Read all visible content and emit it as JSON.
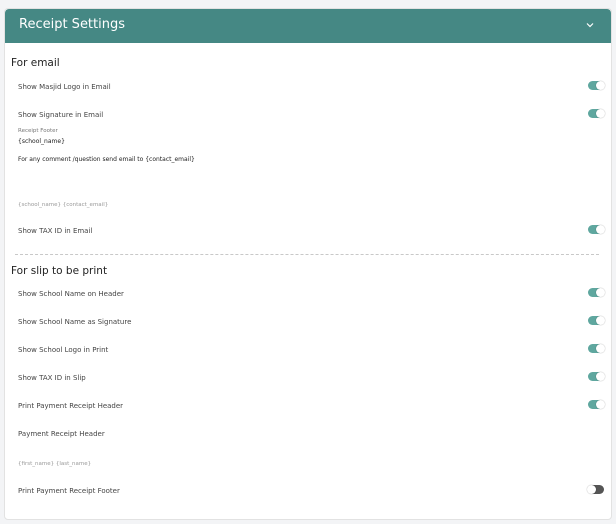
{
  "header": {
    "title": "Receipt Settings",
    "chevron_icon": "chevron-down-icon"
  },
  "colors": {
    "header_bg": "#458884",
    "toggle_on": "#5fa79f",
    "toggle_off": "#555555"
  },
  "email_section": {
    "title": "For email",
    "show_logo": {
      "label": "Show Masjid Logo in Email",
      "on": true
    },
    "show_signature": {
      "label": "Show Signature in Email",
      "on": true
    },
    "footer_label": "Receipt Footer",
    "footer_line1": "{school_name}",
    "footer_line2": "For any comment /question send email to {contact_email}",
    "footer_hint": "{school_name} {contact_email}",
    "show_tax": {
      "label": "Show TAX ID in Email",
      "on": true
    }
  },
  "slip_section": {
    "title": "For slip to be print",
    "school_name_header": {
      "label": "Show School Name on Header",
      "on": true
    },
    "school_name_signature": {
      "label": "Show School Name as Signature",
      "on": true
    },
    "school_logo": {
      "label": "Show School Logo in Print",
      "on": true
    },
    "tax_slip": {
      "label": "Show TAX ID in Slip",
      "on": true
    },
    "print_header": {
      "label": "Print Payment Receipt Header",
      "on": true
    },
    "header_text_label": "Payment Receipt Header",
    "header_hint": "{first_name} {last_name}",
    "print_footer": {
      "label": "Print Payment Receipt Footer",
      "on": false
    }
  }
}
